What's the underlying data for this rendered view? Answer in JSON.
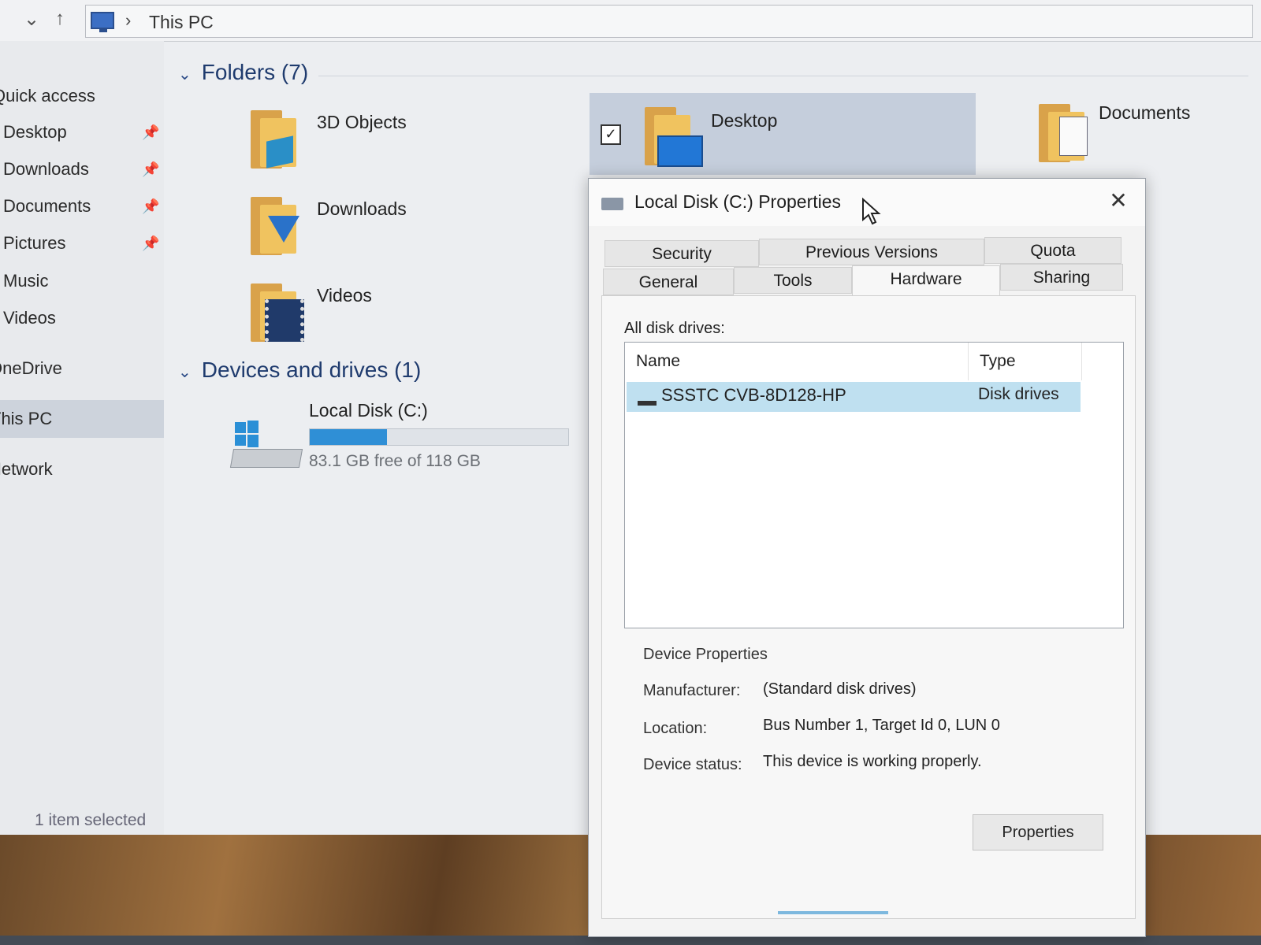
{
  "address": {
    "location": "This PC"
  },
  "sidebar": {
    "items": [
      {
        "label": "Quick access",
        "pinned": false,
        "selected": false
      },
      {
        "label": "Desktop",
        "pinned": true,
        "selected": false
      },
      {
        "label": "Downloads",
        "pinned": true,
        "selected": false
      },
      {
        "label": "Documents",
        "pinned": true,
        "selected": false
      },
      {
        "label": "Pictures",
        "pinned": true,
        "selected": false
      },
      {
        "label": "Music",
        "pinned": false,
        "selected": false
      },
      {
        "label": "Videos",
        "pinned": false,
        "selected": false
      },
      {
        "label": "OneDrive",
        "pinned": false,
        "selected": false
      },
      {
        "label": "This PC",
        "pinned": false,
        "selected": true
      },
      {
        "label": "Network",
        "pinned": false,
        "selected": false
      }
    ],
    "pin_glyph": "📌"
  },
  "content": {
    "folders_header": "Folders (7)",
    "folders": [
      {
        "label": "3D Objects",
        "icon": "3d-objects-icon"
      },
      {
        "label": "Desktop",
        "icon": "desktop-folder-icon",
        "selected": true
      },
      {
        "label": "Documents",
        "icon": "documents-folder-icon"
      },
      {
        "label": "Downloads",
        "icon": "downloads-folder-icon"
      },
      {
        "label": "Videos",
        "icon": "videos-folder-icon"
      }
    ],
    "devices_header": "Devices and drives (1)",
    "drive": {
      "name": "Local Disk (C:)",
      "free_text": "83.1 GB free of 118 GB",
      "used_fraction": 0.3
    }
  },
  "status_bar": {
    "text": "1 item selected"
  },
  "dialog": {
    "title": "Local Disk (C:) Properties",
    "close_glyph": "✕",
    "tabs_row1": [
      "Security",
      "Previous Versions",
      "Quota"
    ],
    "tabs_row2": [
      "General",
      "Tools",
      "Hardware",
      "Sharing"
    ],
    "active_tab": "Hardware",
    "all_disk_drives_label": "All disk drives:",
    "list_columns": [
      "Name",
      "Type"
    ],
    "list_rows": [
      {
        "name": "SSSTC CVB-8D128-HP",
        "type": "Disk drives"
      }
    ],
    "device_properties_title": "Device Properties",
    "properties": [
      {
        "key": "Manufacturer:",
        "value": "(Standard disk drives)"
      },
      {
        "key": "Location:",
        "value": "Bus Number 1, Target Id 0, LUN 0"
      },
      {
        "key": "Device status:",
        "value": "This device is working properly."
      }
    ],
    "properties_button": "Properties"
  },
  "colors": {
    "accent": "#2f8fd6",
    "selection": "#bfe0f0",
    "header_text": "#1f3b6e"
  }
}
